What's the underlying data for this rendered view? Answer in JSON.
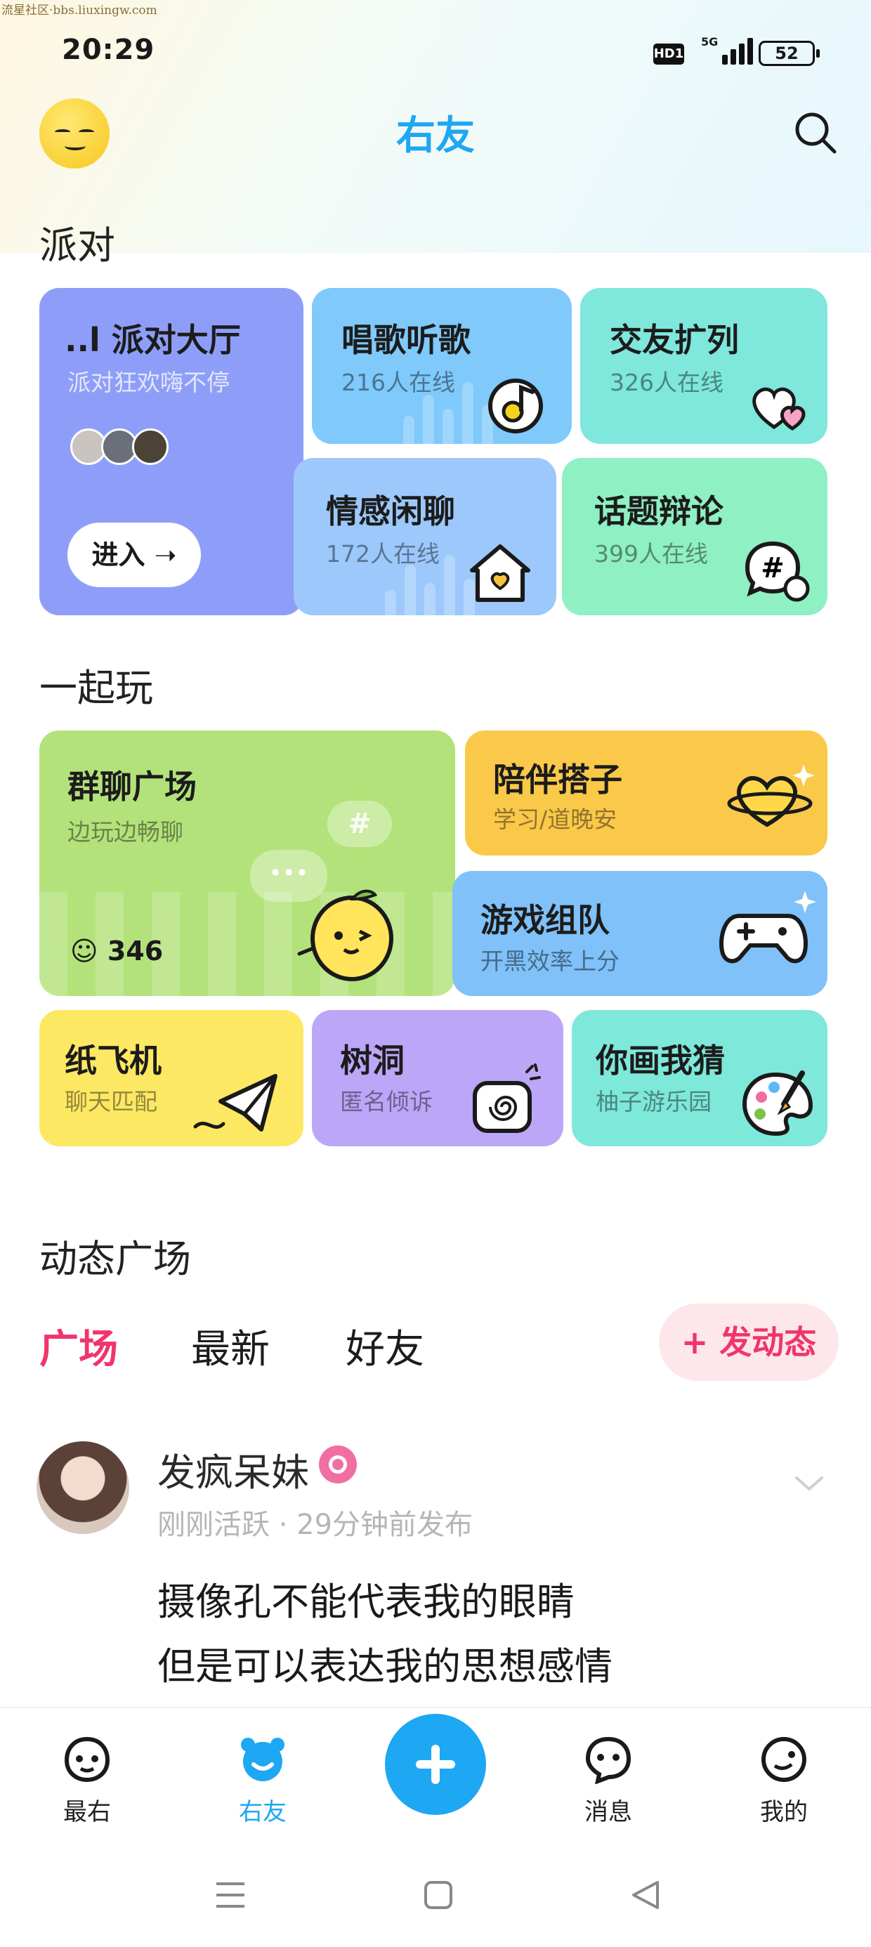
{
  "watermark": "流星社区·bbs.liuxingw.com",
  "status": {
    "time": "20:29",
    "hd": "HD1",
    "network": "5G",
    "battery": "52"
  },
  "header": {
    "title": "右友"
  },
  "party": {
    "section_title": "派对",
    "hall": {
      "title": "..l 派对大厅",
      "subtitle": "派对狂欢嗨不停",
      "enter_label": "进入 ➝"
    },
    "rooms": [
      {
        "title": "唱歌听歌",
        "online": "216人在线"
      },
      {
        "title": "交友扩列",
        "online": "326人在线"
      },
      {
        "title": "情感闲聊",
        "online": "172人在线"
      },
      {
        "title": "话题辩论",
        "online": "399人在线"
      }
    ]
  },
  "play": {
    "section_title": "一起玩",
    "group_chat": {
      "title": "群聊广场",
      "subtitle": "边玩边畅聊",
      "count": "346"
    },
    "companion": {
      "title": "陪伴搭子",
      "subtitle": "学习/道晚安"
    },
    "team": {
      "title": "游戏组队",
      "subtitle": "开黑效率上分"
    },
    "small": [
      {
        "title": "纸飞机",
        "subtitle": "聊天匹配"
      },
      {
        "title": "树洞",
        "subtitle": "匿名倾诉"
      },
      {
        "title": "你画我猜",
        "subtitle": "柚子游乐园"
      }
    ]
  },
  "feed": {
    "section_title": "动态广场",
    "tabs": [
      "广场",
      "最新",
      "好友"
    ],
    "post_button": "+ 发动态",
    "post": {
      "name": "发疯呆妹",
      "meta": "刚刚活跃 · 29分钟前发布",
      "lines": [
        "摄像孔不能代表我的眼睛",
        "但是可以表达我的思想感情"
      ]
    }
  },
  "nav": {
    "items": [
      "最右",
      "右友",
      "消息",
      "我的"
    ]
  },
  "colors": {
    "accent": "#1ea7f2",
    "pink": "#f0356c",
    "hall": "#8e9ef8",
    "sing": "#7fc9fb",
    "friends": "#7fe7db",
    "emotion": "#9cc8fb",
    "debate": "#8ff0c3",
    "group": "#b3e27a",
    "companion": "#fac94a",
    "team": "#7fc1f8",
    "plane": "#fde864",
    "treehole": "#bba6f7",
    "draw": "#7ee8da"
  }
}
